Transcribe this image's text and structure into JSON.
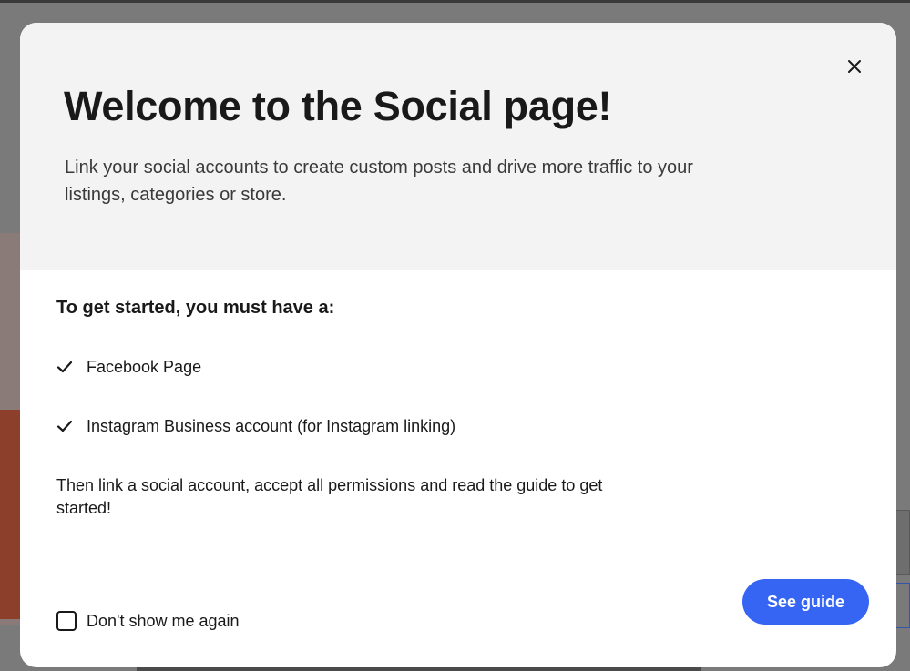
{
  "modal": {
    "title": "Welcome to the Social page!",
    "subtitle": "Link your social accounts to create custom posts and drive more traffic to your listings, categories or store.",
    "close_icon": "close-icon",
    "requirements_heading": "To get started, you must have a:",
    "requirements": [
      {
        "label": "Facebook Page",
        "icon": "check-icon"
      },
      {
        "label": "Instagram Business account (for Instagram linking)",
        "icon": "check-icon"
      }
    ],
    "instructions": "Then link a social account, accept all permissions and read the guide to get started!",
    "dont_show_label": "Don't show me again",
    "dont_show_checked": false,
    "see_guide_label": "See guide"
  },
  "colors": {
    "primary_button": "#3665f3",
    "header_background": "#f3f3f3",
    "text": "#191919"
  }
}
